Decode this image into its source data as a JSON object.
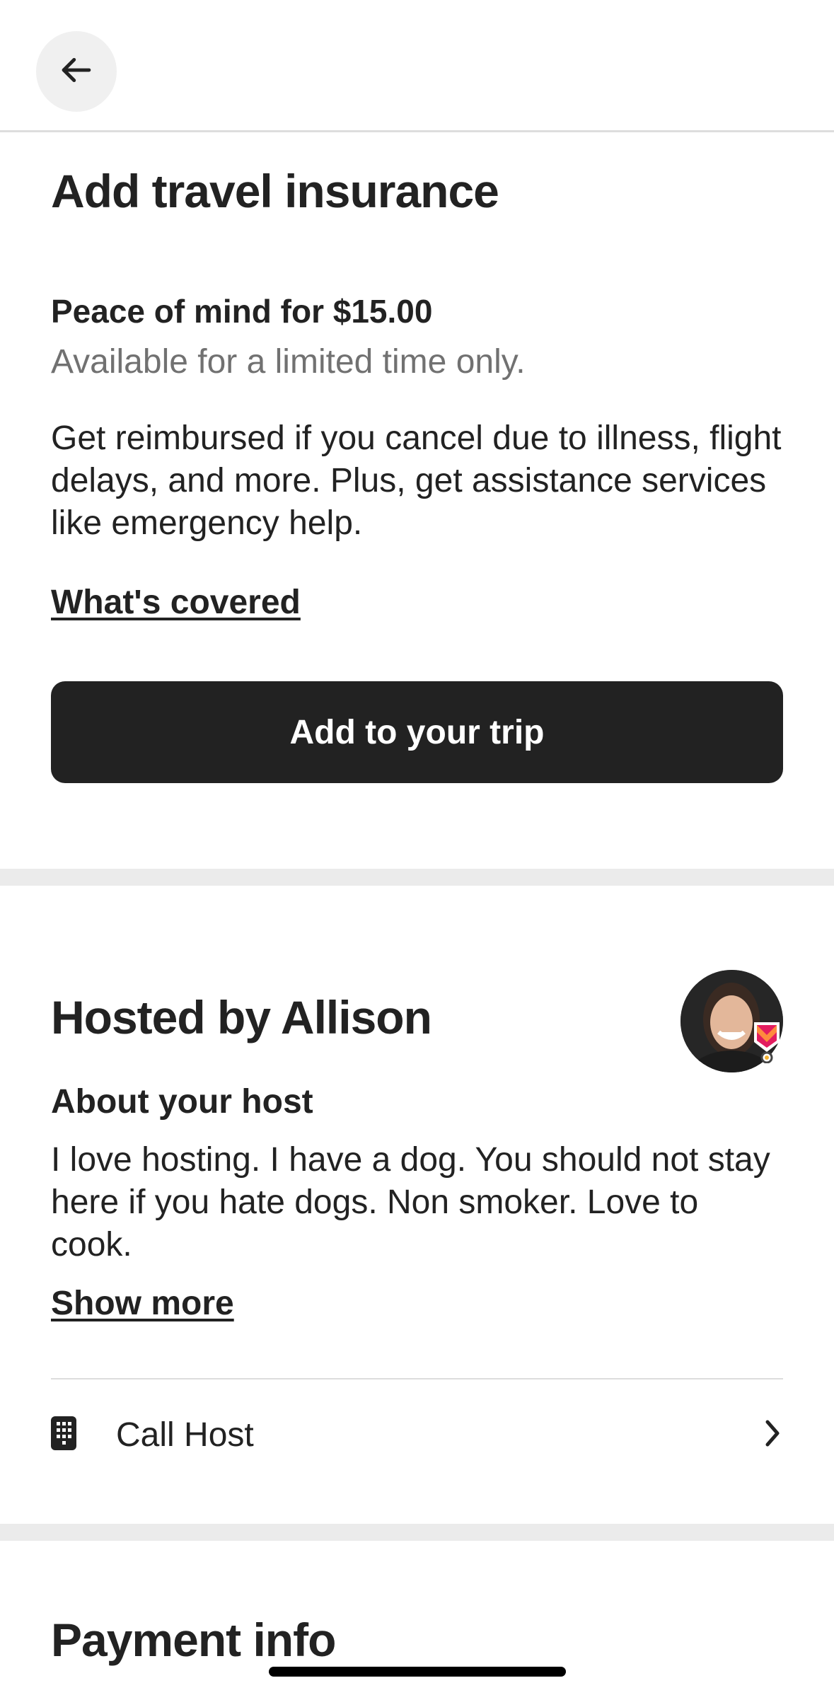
{
  "insurance": {
    "title": "Add travel insurance",
    "headline": "Peace of mind for $15.00",
    "subtitle": "Available for a limited time only.",
    "body": "Get reimbursed if you cancel due to illness, flight delays, and more. Plus, get assistance services like emergency help.",
    "link": "What's covered",
    "button": "Add to your trip"
  },
  "host": {
    "title": "Hosted by Allison",
    "about_label": "About your host",
    "about_body": "I love hosting. I have a  dog. You should not stay here if you hate dogs. Non smoker. Love to cook.",
    "show_more": "Show more",
    "call_label": "Call Host"
  },
  "payment": {
    "title": "Payment info"
  },
  "icons": {
    "back": "arrow-left-icon",
    "phone": "phone-keypad-icon",
    "chevron": "chevron-right-icon",
    "superhost": "superhost-badge-icon"
  },
  "colors": {
    "primary_button": "#222222",
    "muted_text": "#717171",
    "divider": "#ebebeb",
    "badge": "#e31c5f"
  }
}
